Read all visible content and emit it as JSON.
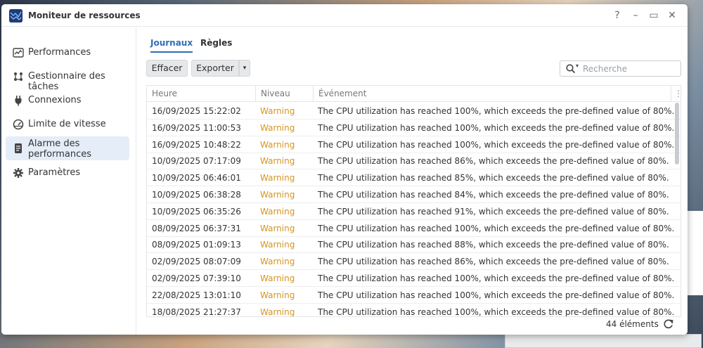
{
  "window": {
    "title": "Moniteur de ressources"
  },
  "titlebar_buttons": {
    "help": "?",
    "minimize": "–",
    "maximize": "▭",
    "close": "✕"
  },
  "sidebar": {
    "items": [
      {
        "label": "Performances",
        "icon": "chart-icon"
      },
      {
        "label": "Gestionnaire des tâches",
        "icon": "task-manager-icon"
      },
      {
        "label": "Connexions",
        "icon": "plug-icon"
      },
      {
        "label": "Limite de vitesse",
        "icon": "speedometer-icon"
      },
      {
        "label": "Alarme des performances",
        "label_line1": "Alarme des",
        "label_line2": "performances",
        "icon": "alarm-document-icon",
        "active": true
      },
      {
        "label": "Paramètres",
        "icon": "gear-icon"
      }
    ]
  },
  "tabs": [
    {
      "label": "Journaux",
      "active": true
    },
    {
      "label": "Règles",
      "active": false
    }
  ],
  "toolbar": {
    "clear_label": "Effacer",
    "export_label": "Exporter"
  },
  "search": {
    "placeholder": "Recherche"
  },
  "table": {
    "columns": [
      "Heure",
      "Niveau",
      "Événement"
    ],
    "rows": [
      {
        "time": "16/09/2025 15:22:02",
        "level": "Warning",
        "event": "The CPU utilization has reached 100%, which exceeds the pre-defined value of 80%."
      },
      {
        "time": "16/09/2025 11:00:53",
        "level": "Warning",
        "event": "The CPU utilization has reached 100%, which exceeds the pre-defined value of 80%."
      },
      {
        "time": "16/09/2025 10:48:22",
        "level": "Warning",
        "event": "The CPU utilization has reached 100%, which exceeds the pre-defined value of 80%."
      },
      {
        "time": "10/09/2025 07:17:09",
        "level": "Warning",
        "event": "The CPU utilization has reached 86%, which exceeds the pre-defined value of 80%."
      },
      {
        "time": "10/09/2025 06:46:01",
        "level": "Warning",
        "event": "The CPU utilization has reached 85%, which exceeds the pre-defined value of 80%."
      },
      {
        "time": "10/09/2025 06:38:28",
        "level": "Warning",
        "event": "The CPU utilization has reached 84%, which exceeds the pre-defined value of 80%."
      },
      {
        "time": "10/09/2025 06:35:26",
        "level": "Warning",
        "event": "The CPU utilization has reached 91%, which exceeds the pre-defined value of 80%."
      },
      {
        "time": "08/09/2025 06:37:31",
        "level": "Warning",
        "event": "The CPU utilization has reached 100%, which exceeds the pre-defined value of 80%."
      },
      {
        "time": "08/09/2025 01:09:13",
        "level": "Warning",
        "event": "The CPU utilization has reached 88%, which exceeds the pre-defined value of 80%."
      },
      {
        "time": "02/09/2025 08:07:09",
        "level": "Warning",
        "event": "The CPU utilization has reached 86%, which exceeds the pre-defined value of 80%."
      },
      {
        "time": "02/09/2025 07:39:10",
        "level": "Warning",
        "event": "The CPU utilization has reached 100%, which exceeds the pre-defined value of 80%."
      },
      {
        "time": "22/08/2025 13:01:10",
        "level": "Warning",
        "event": "The CPU utilization has reached 100%, which exceeds the pre-defined value of 80%."
      },
      {
        "time": "18/08/2025 21:27:37",
        "level": "Warning",
        "event": "The CPU utilization has reached 100%, which exceeds the pre-defined value of 80%."
      }
    ]
  },
  "footer": {
    "count": "44 éléments"
  },
  "colors": {
    "accent": "#2f6eb6",
    "warning": "#d4951f",
    "active_nav": "#e5edf8"
  }
}
